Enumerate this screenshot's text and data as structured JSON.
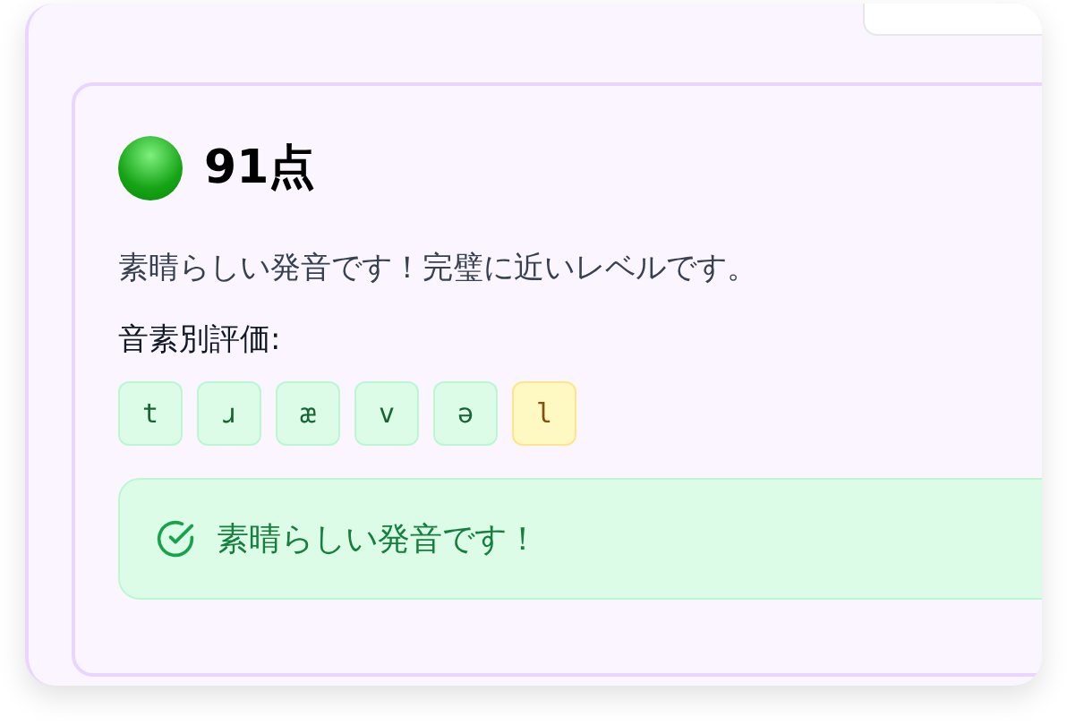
{
  "result": {
    "score": "91点",
    "message": "素晴らしい発音です！完璧に近いレベルです。",
    "phoneme_label": "音素別評価:",
    "phonemes": [
      {
        "symbol": "t",
        "kind": "good"
      },
      {
        "symbol": "ɹ",
        "kind": "good"
      },
      {
        "symbol": "æ",
        "kind": "good"
      },
      {
        "symbol": "v",
        "kind": "good"
      },
      {
        "symbol": "ə",
        "kind": "good"
      },
      {
        "symbol": "l",
        "kind": "fair"
      }
    ],
    "feedback": "素晴らしい発音です！"
  }
}
